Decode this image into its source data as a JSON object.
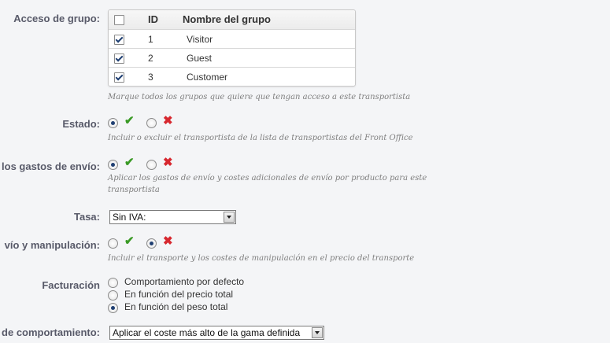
{
  "group_access": {
    "label": "Acceso de grupo:",
    "columns": {
      "id": "ID",
      "name": "Nombre del grupo"
    },
    "header_checked": false,
    "rows": [
      {
        "id": "1",
        "name": "Visitor",
        "checked": true
      },
      {
        "id": "2",
        "name": "Guest",
        "checked": true
      },
      {
        "id": "3",
        "name": "Customer",
        "checked": true
      }
    ],
    "help": "Marque todos los grupos que quiere que tengan acceso a este transportista"
  },
  "estado": {
    "label": "Estado:",
    "value": "yes",
    "help": "Incluir o excluir el transportista de la lista de transportistas del Front Office"
  },
  "shipping_fees": {
    "label": "los gastos de envío:",
    "value": "yes",
    "help": "Aplicar los gastos de envío y costes adicionales de envío por producto para este transportista"
  },
  "tax": {
    "label": "Tasa:",
    "selected": "Sin IVA:"
  },
  "handling": {
    "label": "vío y manipulación:",
    "value": "no",
    "help": "Incluir el transporte y los costes de manipulación en el precio del transporte"
  },
  "billing": {
    "label": "Facturación",
    "options": [
      {
        "label": "Comportamiento por defecto",
        "selected": false
      },
      {
        "label": "En función del precio total",
        "selected": false
      },
      {
        "label": "En función del peso total",
        "selected": true
      }
    ]
  },
  "out_of_range": {
    "label": "de comportamiento:",
    "selected": "Aplicar el coste más alto de la gama definida"
  },
  "icons": {
    "yes": "check-icon",
    "no": "cross-icon"
  },
  "colors": {
    "yes": "#3a9a25",
    "no": "#d7282f",
    "label": "#585a69",
    "help": "#7f7f7f"
  }
}
